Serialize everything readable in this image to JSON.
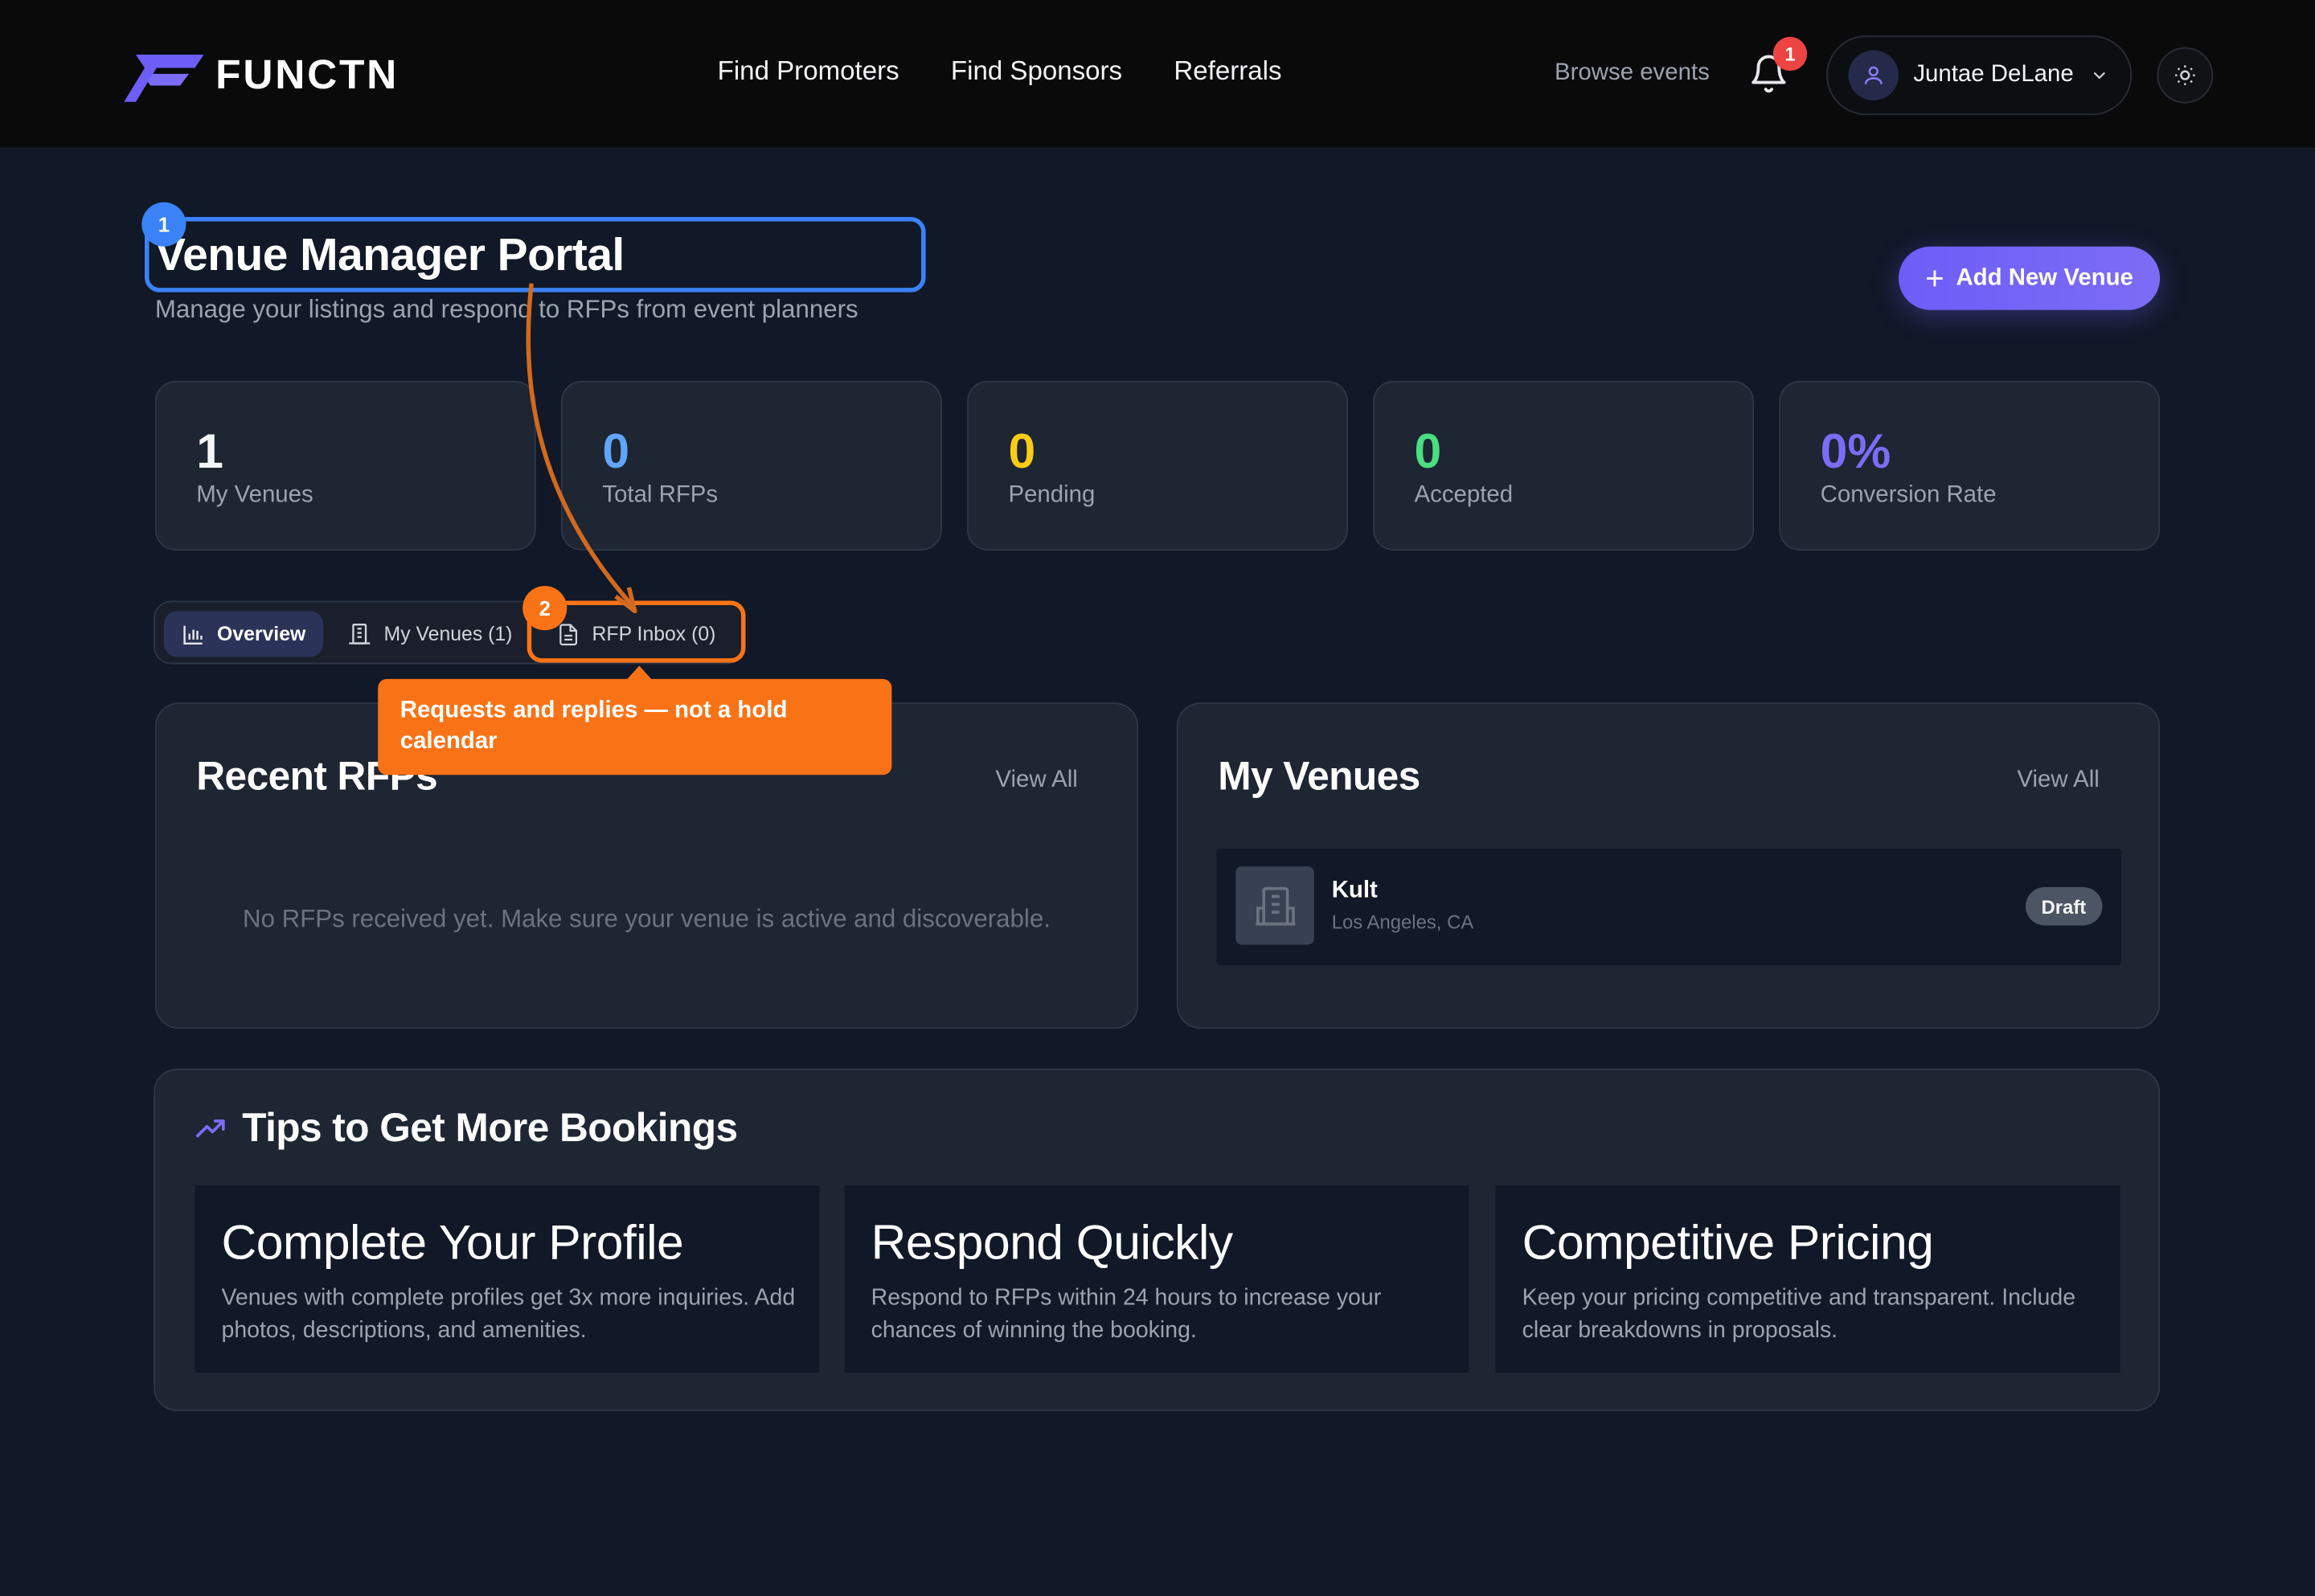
{
  "app": {
    "brand": "FUNCTN"
  },
  "nav": {
    "links": [
      "Find Promoters",
      "Find Sponsors",
      "Referrals"
    ],
    "browse": "Browse events",
    "notification_count": "1",
    "user_name": "Juntae DeLane"
  },
  "page": {
    "title": "Venue Manager Portal",
    "subtitle": "Manage your listings and respond to RFPs from event planners",
    "add_button": "Add New Venue"
  },
  "stats": [
    {
      "value": "1",
      "label": "My Venues",
      "color": "#f3f4f6"
    },
    {
      "value": "0",
      "label": "Total RFPs",
      "color": "#60a5fa"
    },
    {
      "value": "0",
      "label": "Pending",
      "color": "#facc15"
    },
    {
      "value": "0",
      "label": "Accepted",
      "color": "#4ade80"
    },
    {
      "value": "0%",
      "label": "Conversion Rate",
      "color": "#7c6cf5"
    }
  ],
  "tabs": [
    {
      "label": "Overview",
      "icon": "bar-chart-icon",
      "active": true
    },
    {
      "label": "My Venues (1)",
      "icon": "building-icon",
      "active": false
    },
    {
      "label": "RFP Inbox (0)",
      "icon": "document-icon",
      "active": false
    }
  ],
  "annotations": {
    "marker1": "1",
    "marker2": "2",
    "callout": "Requests and replies — not a hold calendar"
  },
  "recent_rfps": {
    "title": "Recent RFPs",
    "view_all": "View All",
    "empty": "No RFPs received yet. Make sure your venue is active and discoverable."
  },
  "my_venues": {
    "title": "My Venues",
    "view_all": "View All",
    "items": [
      {
        "name": "Kult",
        "location": "Los Angeles, CA",
        "status": "Draft"
      }
    ]
  },
  "tips": {
    "title": "Tips to Get More Bookings",
    "cards": [
      {
        "title": "Complete Your Profile",
        "desc": "Venues with complete profiles get 3x more inquiries. Add photos, descriptions, and amenities."
      },
      {
        "title": "Respond Quickly",
        "desc": "Respond to RFPs within 24 hours to increase your chances of winning the booking."
      },
      {
        "title": "Competitive Pricing",
        "desc": "Keep your pricing competitive and transparent. Include clear breakdowns in proposals."
      }
    ]
  }
}
